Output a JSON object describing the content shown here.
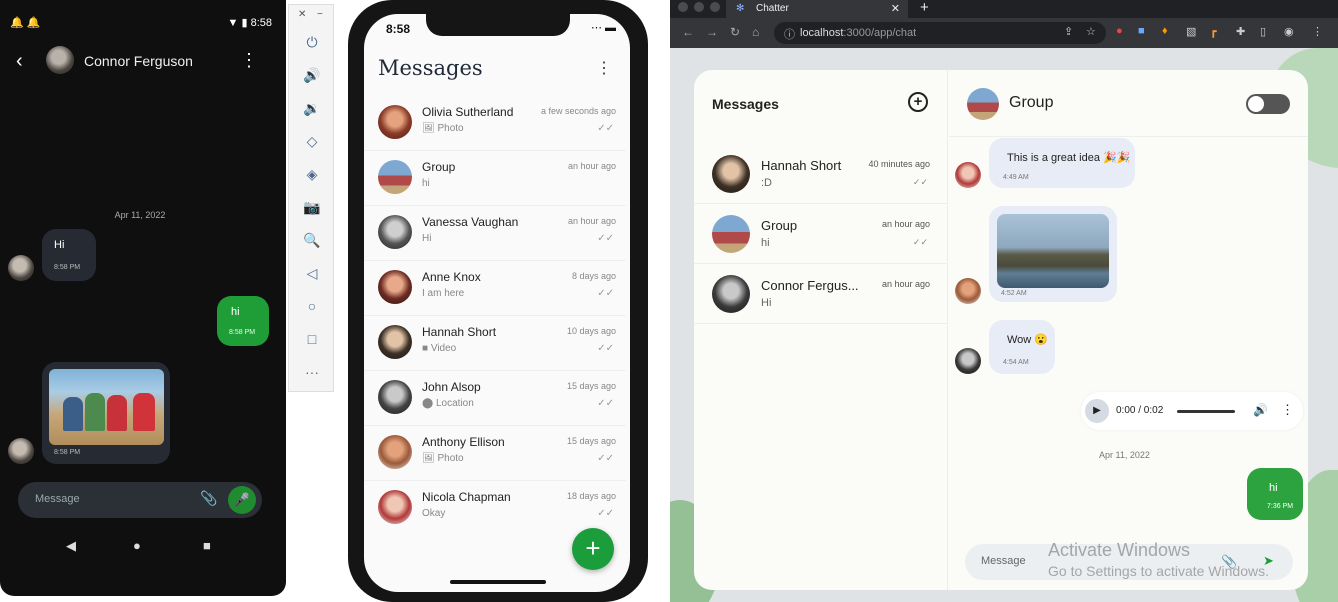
{
  "android": {
    "status_time": "8:58",
    "contact_name": "Connor Ferguson",
    "date_divider": "Apr 11, 2022",
    "messages": [
      {
        "text": "Hi",
        "time": "8:58 PM"
      },
      {
        "text": "hi",
        "time": "8:58 PM"
      },
      {
        "text": "",
        "time": "8:58 PM"
      }
    ],
    "compose_placeholder": "Message"
  },
  "iphone": {
    "status_time": "8:58",
    "title": "Messages",
    "conversations": [
      {
        "name": "Olivia Sutherland",
        "preview": "Photo",
        "preview_icon": "image-icon",
        "time": "a few seconds ago"
      },
      {
        "name": "Group",
        "preview": "hi",
        "preview_icon": "",
        "time": "an hour ago"
      },
      {
        "name": "Vanessa Vaughan",
        "preview": "Hi",
        "preview_icon": "",
        "time": "an hour ago"
      },
      {
        "name": "Anne Knox",
        "preview": "I am here",
        "preview_icon": "",
        "time": "8 days ago"
      },
      {
        "name": "Hannah Short",
        "preview": "Video",
        "preview_icon": "video-icon",
        "time": "10 days ago"
      },
      {
        "name": "John Alsop",
        "preview": "Location",
        "preview_icon": "location-icon",
        "time": "15 days ago"
      },
      {
        "name": "Anthony Ellison",
        "preview": "Photo",
        "preview_icon": "image-icon",
        "time": "15 days ago"
      },
      {
        "name": "Nicola Chapman",
        "preview": "Okay",
        "preview_icon": "",
        "time": "18 days ago"
      }
    ]
  },
  "browser": {
    "tab_title": "Chatter",
    "url_host": "localhost",
    "url_rest": ":3000/app/chat",
    "sidebar_title": "Messages",
    "chats": [
      {
        "name": "Hannah Short",
        "preview": ":D",
        "time": "40 minutes ago"
      },
      {
        "name": "Group",
        "preview": "hi",
        "time": "an hour ago"
      },
      {
        "name": "Connor Fergus...",
        "preview": "Hi",
        "time": "an hour ago"
      }
    ],
    "active_chat": "Group",
    "messages": [
      {
        "text": "This is a great idea 🎉🎉",
        "time": "4:49 AM"
      },
      {
        "text": "",
        "time": "4:52 AM"
      },
      {
        "text": "Wow 😮",
        "time": "4:54 AM"
      }
    ],
    "audio_time": "0:00 / 0:02",
    "date_divider": "Apr 11, 2022",
    "sent_message": {
      "text": "hi",
      "time": "7:36 PM"
    },
    "compose_placeholder": "Message",
    "watermark_line1": "Activate Windows",
    "watermark_line2": "Go to Settings to activate Windows."
  },
  "colors": {
    "accent_green": "#1a9d3a",
    "android_bg": "#0f0f0f",
    "bubble_received": "#e8ecf6"
  }
}
